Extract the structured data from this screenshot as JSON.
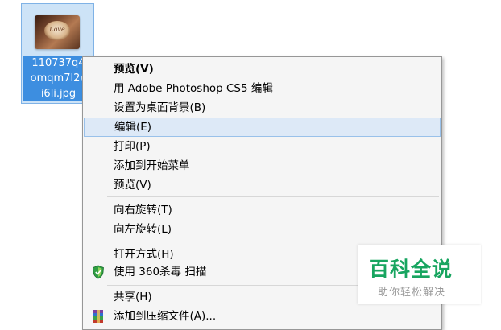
{
  "file": {
    "name_lines": [
      "110737q4",
      "omqm7l2e",
      "i6li.jpg"
    ],
    "thumbnail_icon": "love-latte-thumbnail"
  },
  "context_menu": {
    "items": [
      {
        "label": "预览(V)",
        "bold": true
      },
      {
        "label": "用 Adobe Photoshop CS5 编辑"
      },
      {
        "label": "设置为桌面背景(B)"
      },
      {
        "label": "编辑(E)",
        "highlighted": true
      },
      {
        "label": "打印(P)"
      },
      {
        "label": "添加到开始菜单"
      },
      {
        "label": "预览(V)"
      },
      {
        "label": "向右旋转(T)"
      },
      {
        "label": "向左旋转(L)"
      },
      {
        "label": "打开方式(H)"
      },
      {
        "label": "使用 360杀毒 扫描",
        "icon": "shield-icon"
      },
      {
        "label": "共享(H)"
      },
      {
        "label": "添加到压缩文件(A)...",
        "icon": "winrar-icon"
      }
    ]
  },
  "watermark": {
    "title": "百科全说",
    "subtitle": "助你轻松解决"
  },
  "colors": {
    "highlight_bg": "#dde9f7",
    "highlight_border": "#99c1ea",
    "watermark_green": "#18a560",
    "selection_blue": "#3d8ee0"
  }
}
